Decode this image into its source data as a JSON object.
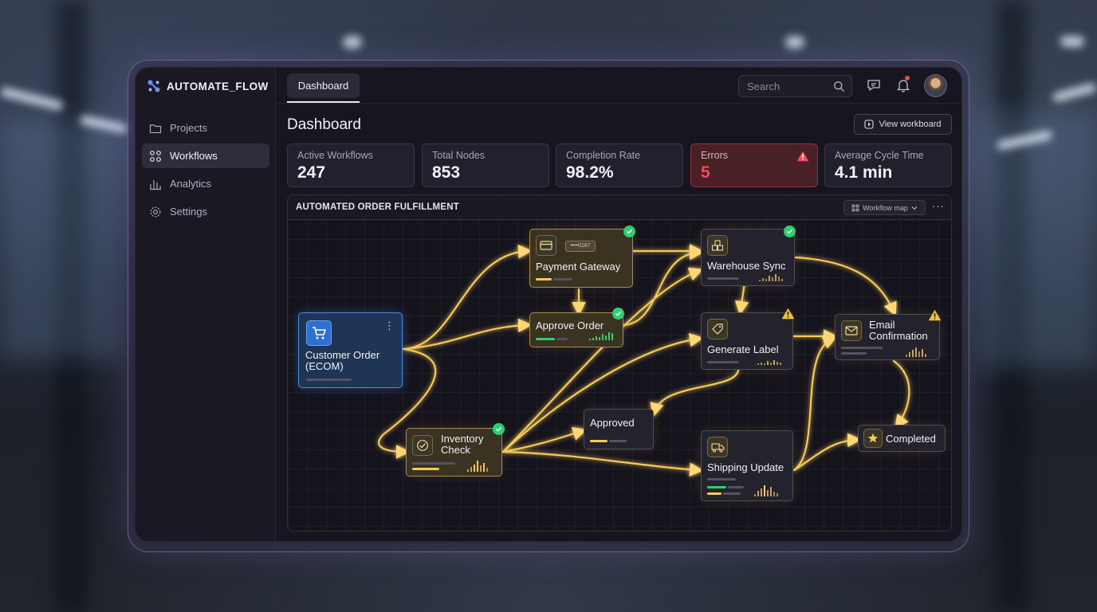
{
  "brand": {
    "name": "AUTOMATE_FLOW"
  },
  "sidebar": {
    "items": [
      {
        "label": "Projects",
        "icon": "folder-icon",
        "active": false
      },
      {
        "label": "Workflows",
        "icon": "workflows-icon",
        "active": true
      },
      {
        "label": "Analytics",
        "icon": "bar-chart-icon",
        "active": false
      },
      {
        "label": "Settings",
        "icon": "gear-icon",
        "active": false
      }
    ]
  },
  "topbar": {
    "tab_label": "Dashboard",
    "search_placeholder": "Search"
  },
  "page": {
    "title": "Dashboard",
    "view_button": "View workboard"
  },
  "stats": [
    {
      "label": "Active Workflows",
      "value": "247"
    },
    {
      "label": "Total Nodes",
      "value": "853"
    },
    {
      "label": "Completion Rate",
      "value": "98.2%"
    },
    {
      "label": "Errors",
      "value": "5",
      "status": "error"
    },
    {
      "label": "Average Cycle Time",
      "value": "4.1 min"
    }
  ],
  "workflow": {
    "title": "AUTOMATED ORDER FULFILLMENT",
    "view_select": "Workflow map",
    "more_label": "···",
    "nodes": {
      "customer_order": {
        "title": "Customer Order\n(ECOM)",
        "icon": "cart-icon"
      },
      "payment_gateway": {
        "title": "Payment Gateway",
        "icon": "credit-card-icon",
        "status": "success",
        "chip": "••••0187"
      },
      "approve_order": {
        "title": "Approve Order",
        "status": "success"
      },
      "warehouse_sync": {
        "title": "Warehouse Sync",
        "icon": "boxes-icon",
        "status": "success"
      },
      "generate_label": {
        "title": "Generate Label",
        "icon": "tag-icon",
        "status": "warning"
      },
      "email_confirmation": {
        "title": "Email\nConfirmation",
        "icon": "envelope-icon",
        "status": "warning"
      },
      "inventory_check": {
        "title": "Inventory\nCheck",
        "icon": "check-circle-icon",
        "status": "success"
      },
      "approved": {
        "title": "Approved"
      },
      "shipping_update": {
        "title": "Shipping Update",
        "icon": "truck-icon"
      },
      "completed": {
        "title": "Completed",
        "icon": "star-icon"
      }
    }
  },
  "colors": {
    "accent_gold": "#f5c95a",
    "success": "#2ecf6e",
    "warning": "#f0c23a",
    "error": "#ef4d5c",
    "active_blue": "#4e8ad6"
  }
}
